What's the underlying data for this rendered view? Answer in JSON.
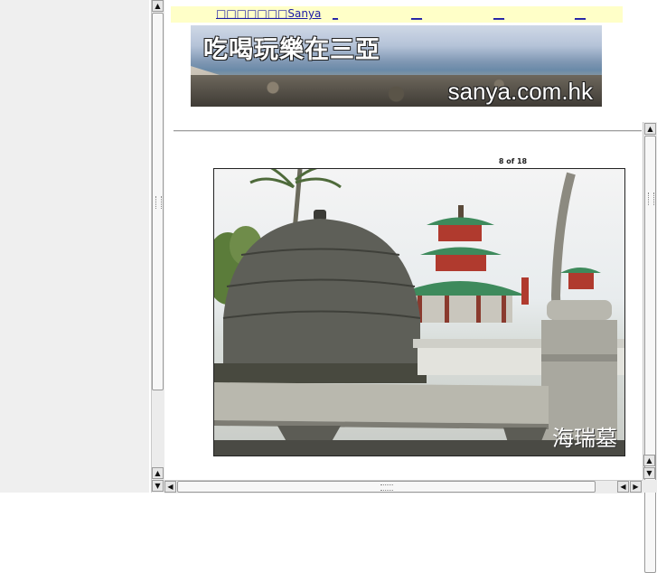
{
  "top_bar": {
    "brand_link": "Sanya",
    "brand_prefix": "□□□□□□□",
    "links": [
      "_",
      "__",
      "__",
      "__"
    ]
  },
  "banner": {
    "title": "吃喝玩樂在三亞",
    "url_text": "sanya.com.hk"
  },
  "slideshow": {
    "counter": "8 of 18",
    "watermark": "海瑞墓"
  },
  "icons": {
    "scroll_up": "scroll-up-arrow-icon",
    "scroll_down": "scroll-down-arrow-icon",
    "scroll_left": "scroll-left-arrow-icon",
    "scroll_right": "scroll-right-arrow-icon"
  },
  "colors": {
    "link": "#1a1aa6",
    "top_bar_bg": "#ffffc8",
    "roof_green": "#3e8a5c",
    "pillar_red": "#b03a2e"
  }
}
